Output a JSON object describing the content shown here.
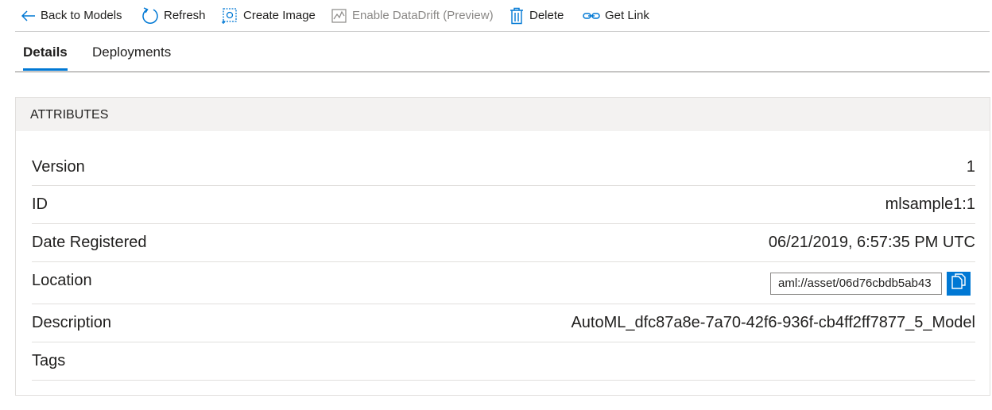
{
  "toolbar": {
    "back": {
      "label": "Back to Models",
      "icon": "arrow-left-icon"
    },
    "refresh": {
      "label": "Refresh",
      "icon": "refresh-icon"
    },
    "create_image": {
      "label": "Create Image",
      "icon": "create-image-icon"
    },
    "enable_datadrift": {
      "label": "Enable DataDrift (Preview)",
      "icon": "chart-icon",
      "disabled": true
    },
    "delete": {
      "label": "Delete",
      "icon": "trash-icon"
    },
    "get_link": {
      "label": "Get Link",
      "icon": "link-icon"
    }
  },
  "tabs": [
    {
      "label": "Details",
      "active": true
    },
    {
      "label": "Deployments",
      "active": false
    }
  ],
  "attributes": {
    "header": "ATTRIBUTES",
    "rows": [
      {
        "key": "Version",
        "value": "1"
      },
      {
        "key": "ID",
        "value": "mlsample1:1"
      },
      {
        "key": "Date Registered",
        "value": "06/21/2019, 6:57:35 PM UTC"
      },
      {
        "key": "Location",
        "value": "aml://asset/06d76cbdb5ab43",
        "copy_icon": "copy-icon"
      },
      {
        "key": "Description",
        "value": "AutoML_dfc87a8e-7a70-42f6-936f-cb4ff2ff7877_5_Model"
      },
      {
        "key": "Tags",
        "value": ""
      }
    ]
  },
  "colors": {
    "accent": "#0078d4",
    "text": "#201f1e",
    "disabled": "#8a8886",
    "header_bg": "#f3f2f1",
    "divider": "#e1dfdd"
  }
}
